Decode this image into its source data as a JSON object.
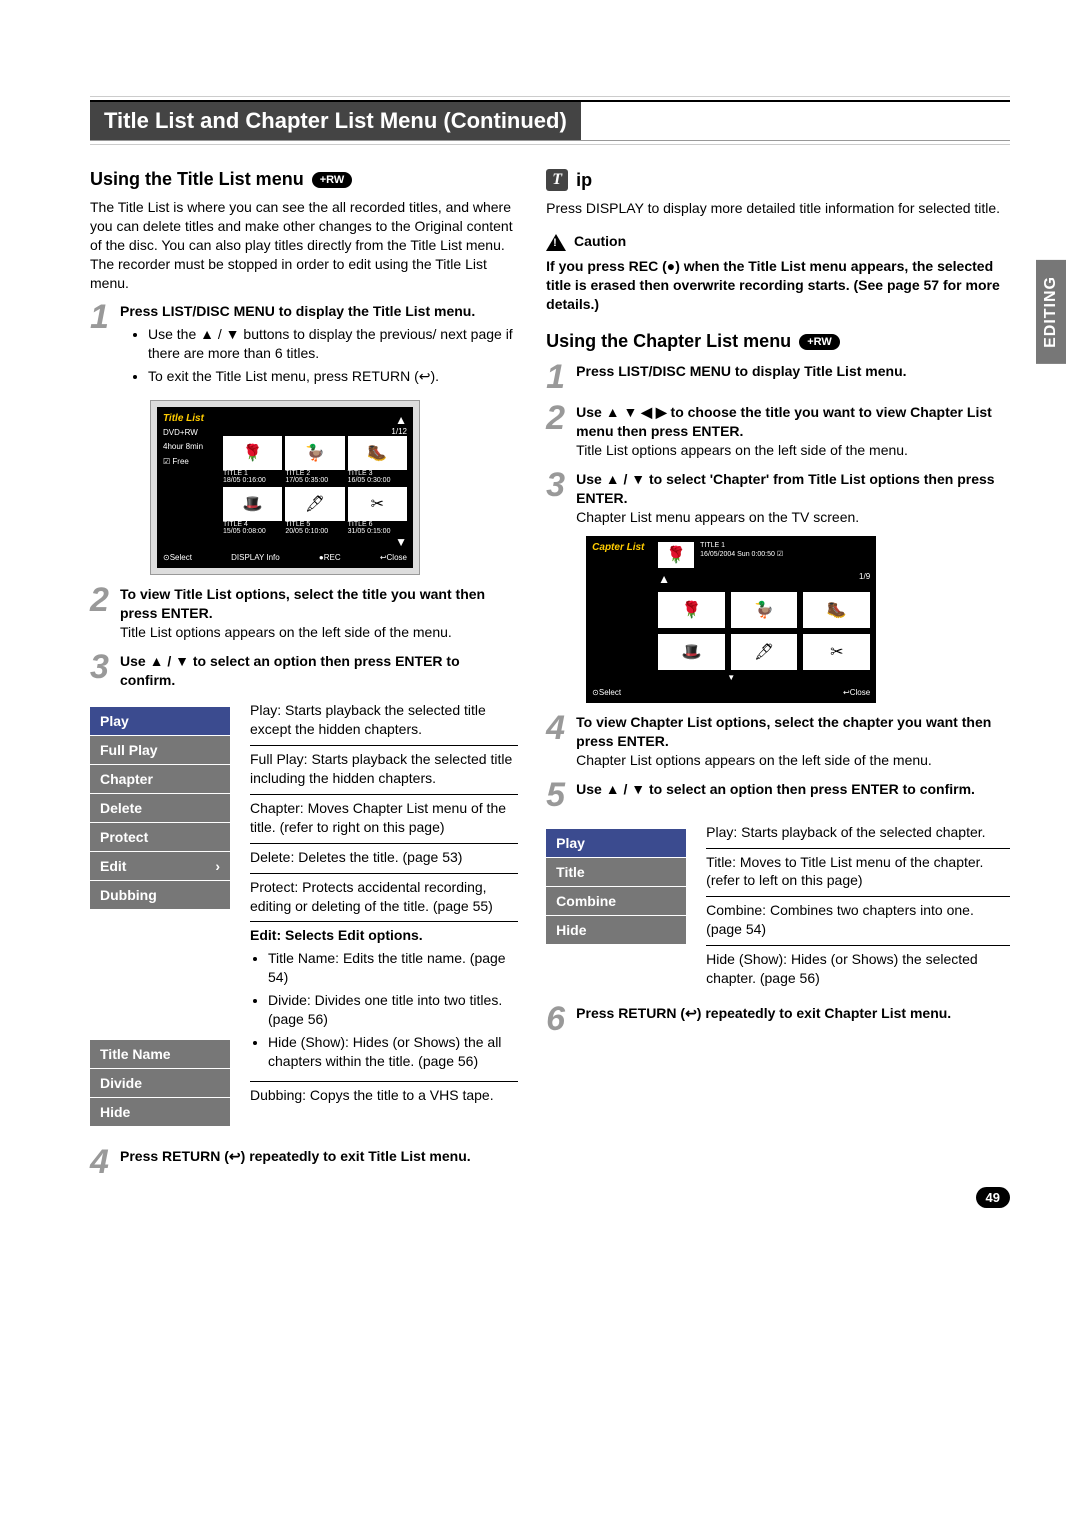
{
  "page_title": "Title List and Chapter List Menu (Continued)",
  "side_tab": "EDITING",
  "page_number": "49",
  "left": {
    "heading": "Using the Title List menu",
    "badge": "+RW",
    "intro": "The Title List is where you can see the all recorded titles, and where you can delete titles and make other changes to the Original content of the disc. You can also play titles directly from the Title List menu. The recorder must be stopped in order to edit using the Title List menu.",
    "step1_bold": "Press LIST/DISC MENU to display the Title List menu.",
    "step1_b1": "Use the ▲ / ▼ buttons to display the previous/ next page if there are more than 6 titles.",
    "step1_b2": "To exit the Title List menu, press RETURN (↩).",
    "shot": {
      "title": "Title List",
      "count": "1/12",
      "side_label": "DVD+RW",
      "side_free1": "4hour 8min",
      "side_free2": "☑ Free",
      "titles": [
        {
          "name": "TITLE 1",
          "meta": "18/05  0:16:00",
          "glyph": "🌹"
        },
        {
          "name": "TITLE 2",
          "meta": "17/05  0:35:00",
          "glyph": "🦆"
        },
        {
          "name": "TITLE 3",
          "meta": "16/05  0:30:00",
          "glyph": "🥾"
        },
        {
          "name": "TITLE 4",
          "meta": "15/05  0:08:00",
          "glyph": "🎩"
        },
        {
          "name": "TITLE 5",
          "meta": "20/05  0:10:00",
          "glyph": "🖋"
        },
        {
          "name": "TITLE 6",
          "meta": "31/05  0:15:00",
          "glyph": "✂"
        }
      ],
      "foot_select": "⊙Select",
      "foot_info": "DISPLAY Info",
      "foot_rec": "●REC",
      "foot_close": "↩Close"
    },
    "step2_bold": "To view Title List options, select the title you want then press ENTER.",
    "step2_text": "Title List options appears on the left side of the menu.",
    "step3_bold": "Use ▲ / ▼ to select an option then press ENTER to confirm.",
    "menu1": [
      "Play",
      "Full Play",
      "Chapter",
      "Delete",
      "Protect",
      "Edit",
      "Dubbing"
    ],
    "menu1_arrow_index": 5,
    "opts": {
      "play": "Play: Starts playback the selected title except the hidden chapters.",
      "fullplay": "Full Play: Starts playback the selected title including the hidden chapters.",
      "chapter": "Chapter: Moves Chapter List menu of the title. (refer to right on this page)",
      "delete": "Delete: Deletes the title. (page 53)",
      "protect": "Protect: Protects accidental recording, editing or deleting of the title. (page 55)",
      "edit_head": "Edit: Selects Edit options.",
      "edit_b1": "Title Name: Edits the title name. (page 54)",
      "edit_b2": "Divide: Divides one title into two titles. (page 56)",
      "edit_b3": "Hide (Show): Hides (or Shows) the all chapters within the title. (page 56)",
      "dubbing": "Dubbing: Copys the title to a VHS tape."
    },
    "menu2": [
      "Title Name",
      "Divide",
      "Hide"
    ],
    "step4_bold": "Press RETURN (↩) repeatedly to exit Title List menu."
  },
  "right": {
    "tip_label": "ip",
    "tip_text": "Press DISPLAY to display more detailed title information for selected title.",
    "caution_label": "Caution",
    "caution_text": "If you press REC (●) when the Title List menu appears, the selected title is erased then overwrite recording starts. (See page 57 for more details.)",
    "heading": "Using the Chapter List menu",
    "badge": "+RW",
    "step1_bold": "Press LIST/DISC MENU to display Title List menu.",
    "step2_bold": "Use ▲ ▼ ◀ ▶ to choose the title you want to view Chapter List menu then press ENTER.",
    "step2_text": "Title List options appears on the left side of the menu.",
    "step3_bold": "Use ▲ / ▼ to select 'Chapter' from Title List options then press ENTER.",
    "step3_text": "Chapter List menu appears on the TV screen.",
    "shot": {
      "title": "Capter List",
      "meta_title": "TITLE 1",
      "meta_date": "16/05/2004 Sun 0:00:50  ☑",
      "count": "1/9",
      "thumbs": [
        "🌹",
        "🦆",
        "🥾",
        "🎩",
        "🖋",
        "✂"
      ],
      "foot_select": "⊙Select",
      "foot_close": "↩Close"
    },
    "step4_bold": "To view Chapter List options, select the chapter you want then press ENTER.",
    "step4_text": "Chapter List options appears on the left side of the menu.",
    "step5_bold": "Use ▲ / ▼ to select an option then press ENTER to confirm.",
    "menu": [
      "Play",
      "Title",
      "Combine",
      "Hide"
    ],
    "opts": {
      "play": "Play: Starts playback of the selected chapter.",
      "title": "Title: Moves to Title List menu of the chapter. (refer to left on this page)",
      "combine": "Combine: Combines two chapters into one. (page 54)",
      "hide": "Hide (Show): Hides (or Shows) the selected chapter. (page 56)"
    },
    "step6_bold": "Press RETURN (↩) repeatedly to exit Chapter List menu."
  }
}
